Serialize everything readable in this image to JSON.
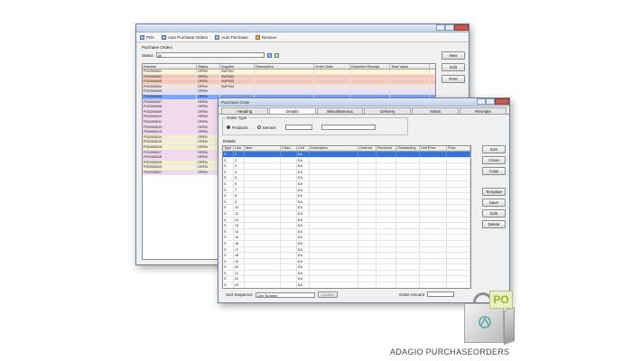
{
  "back_window": {
    "toolbar": {
      "items": [
        "POs",
        "Auto Purchase Orders",
        "Auto Purchase",
        "Receive"
      ]
    },
    "filter": {
      "group_label": "Purchase Orders",
      "status_label": "Status",
      "status_value": "All"
    },
    "grid": {
      "columns": [
        "Number",
        "Status",
        "Supplier",
        "Description",
        "Order Date",
        "Expected Receipt",
        "Total Value"
      ],
      "rows": [
        {
          "number": "PO0000001",
          "status": "OPEN",
          "supplier": "SUP001",
          "description": "",
          "order_date": "",
          "expected": "",
          "total": "",
          "color": "#fff5d9"
        },
        {
          "number": "PO0000002",
          "status": "OPEN",
          "supplier": "SUP002",
          "description": "",
          "order_date": "",
          "expected": "",
          "total": "",
          "color": "#f7c8b8"
        },
        {
          "number": "PO0000003",
          "status": "OPEN",
          "supplier": "SUP003",
          "description": "",
          "order_date": "",
          "expected": "",
          "total": "",
          "color": "#f7c8b8"
        },
        {
          "number": "PO0000004",
          "status": "OPEN",
          "supplier": "SUP004",
          "description": "",
          "order_date": "",
          "expected": "",
          "total": "",
          "color": "#f5e2e2"
        },
        {
          "number": "PO0000005",
          "status": "OPEN",
          "supplier": "",
          "description": "",
          "order_date": "",
          "expected": "",
          "total": "",
          "color": "#e8e0f5"
        },
        {
          "number": "PO0000006",
          "status": "OPEN",
          "supplier": "",
          "description": "",
          "order_date": "",
          "expected": "",
          "total": "",
          "color": "#7fa6ff"
        },
        {
          "number": "PO0000007",
          "status": "OPEN",
          "supplier": "",
          "description": "",
          "order_date": "",
          "expected": "",
          "total": "",
          "color": "#f5d8f0"
        },
        {
          "number": "PO0000008",
          "status": "OPEN",
          "supplier": "",
          "description": "",
          "order_date": "",
          "expected": "",
          "total": "",
          "color": "#f5d8f0"
        },
        {
          "number": "PO0000009",
          "status": "OPEN",
          "supplier": "",
          "description": "",
          "order_date": "",
          "expected": "",
          "total": "",
          "color": "#f5d8f0"
        },
        {
          "number": "PO0000010",
          "status": "OPEN",
          "supplier": "",
          "description": "",
          "order_date": "",
          "expected": "",
          "total": "",
          "color": "#f5d8f0"
        },
        {
          "number": "PO0000011",
          "status": "OPEN",
          "supplier": "",
          "description": "",
          "order_date": "",
          "expected": "",
          "total": "",
          "color": "#f5d8f0"
        },
        {
          "number": "PO0000012",
          "status": "OPEN",
          "supplier": "",
          "description": "",
          "order_date": "",
          "expected": "",
          "total": "",
          "color": "#f5d8f0"
        },
        {
          "number": "PO0000013",
          "status": "OPEN",
          "supplier": "",
          "description": "",
          "order_date": "",
          "expected": "",
          "total": "",
          "color": "#f5d8f0"
        },
        {
          "number": "PO0000014",
          "status": "OPEN",
          "supplier": "",
          "description": "",
          "order_date": "",
          "expected": "",
          "total": "",
          "color": "#f5f0d2"
        },
        {
          "number": "PO0000015",
          "status": "OPEN",
          "supplier": "",
          "description": "",
          "order_date": "",
          "expected": "",
          "total": "",
          "color": "#f5f0d2"
        },
        {
          "number": "PO0000016",
          "status": "OPEN",
          "supplier": "",
          "description": "",
          "order_date": "",
          "expected": "",
          "total": "",
          "color": "#f5f0d2"
        },
        {
          "number": "PO0000017",
          "status": "OPEN",
          "supplier": "",
          "description": "",
          "order_date": "",
          "expected": "",
          "total": "",
          "color": "#f5d8f0"
        },
        {
          "number": "PO0000018",
          "status": "OPEN",
          "supplier": "",
          "description": "",
          "order_date": "",
          "expected": "",
          "total": "",
          "color": "#f5d8f0"
        },
        {
          "number": "PO0000019",
          "status": "OPEN",
          "supplier": "",
          "description": "",
          "order_date": "",
          "expected": "",
          "total": "",
          "color": "#f5f0d2"
        },
        {
          "number": "PO0000020",
          "status": "OPEN",
          "supplier": "",
          "description": "",
          "order_date": "",
          "expected": "",
          "total": "",
          "color": "#f5f0d2"
        },
        {
          "number": "PO0000021",
          "status": "OPEN",
          "supplier": "",
          "description": "",
          "order_date": "",
          "expected": "",
          "total": "",
          "color": "#f5d8f0"
        }
      ]
    },
    "side_buttons": [
      "New",
      "Edit",
      "Print"
    ]
  },
  "front_window": {
    "title": "Purchase Order",
    "tabs": [
      "Heading",
      "Details",
      "Miscellaneous",
      "Delivery",
      "Notes",
      "Receipts"
    ],
    "order_type_label": "Order Type",
    "radio_product": "Products",
    "radio_service": "Service",
    "lines_label": "Details",
    "grid": {
      "columns": [
        "Type",
        "Line",
        "Item",
        "Class",
        "Unit",
        "Description",
        "Ordered",
        "Received",
        "Outstanding",
        "Unit Price",
        "Price"
      ],
      "rows": [
        {
          "type": "S",
          "line": "1",
          "item": "",
          "class": "",
          "unit": "EA",
          "description": "",
          "ordered": "",
          "received": "",
          "outstanding": "",
          "unit_price": "",
          "price": ""
        },
        {
          "type": "S",
          "line": "2",
          "item": "",
          "class": "",
          "unit": "EA",
          "description": "",
          "ordered": "",
          "received": "",
          "outstanding": "",
          "unit_price": "",
          "price": ""
        },
        {
          "type": "S",
          "line": "3",
          "item": "",
          "class": "",
          "unit": "EA",
          "description": "",
          "ordered": "",
          "received": "",
          "outstanding": "",
          "unit_price": "",
          "price": ""
        },
        {
          "type": "S",
          "line": "4",
          "item": "",
          "class": "",
          "unit": "EA",
          "description": "",
          "ordered": "",
          "received": "",
          "outstanding": "",
          "unit_price": "",
          "price": ""
        },
        {
          "type": "S",
          "line": "5",
          "item": "",
          "class": "",
          "unit": "EA",
          "description": "",
          "ordered": "",
          "received": "",
          "outstanding": "",
          "unit_price": "",
          "price": ""
        },
        {
          "type": "S",
          "line": "6",
          "item": "",
          "class": "",
          "unit": "EA",
          "description": "",
          "ordered": "",
          "received": "",
          "outstanding": "",
          "unit_price": "",
          "price": ""
        },
        {
          "type": "S",
          "line": "7",
          "item": "",
          "class": "",
          "unit": "EA",
          "description": "",
          "ordered": "",
          "received": "",
          "outstanding": "",
          "unit_price": "",
          "price": ""
        },
        {
          "type": "S",
          "line": "8",
          "item": "",
          "class": "",
          "unit": "EA",
          "description": "",
          "ordered": "",
          "received": "",
          "outstanding": "",
          "unit_price": "",
          "price": ""
        },
        {
          "type": "S",
          "line": "9",
          "item": "",
          "class": "",
          "unit": "EA",
          "description": "",
          "ordered": "",
          "received": "",
          "outstanding": "",
          "unit_price": "",
          "price": ""
        },
        {
          "type": "S",
          "line": "10",
          "item": "",
          "class": "",
          "unit": "EA",
          "description": "",
          "ordered": "",
          "received": "",
          "outstanding": "",
          "unit_price": "",
          "price": ""
        },
        {
          "type": "S",
          "line": "11",
          "item": "",
          "class": "",
          "unit": "EA",
          "description": "",
          "ordered": "",
          "received": "",
          "outstanding": "",
          "unit_price": "",
          "price": ""
        },
        {
          "type": "S",
          "line": "12",
          "item": "",
          "class": "",
          "unit": "EA",
          "description": "",
          "ordered": "",
          "received": "",
          "outstanding": "",
          "unit_price": "",
          "price": ""
        },
        {
          "type": "S",
          "line": "13",
          "item": "",
          "class": "",
          "unit": "EA",
          "description": "",
          "ordered": "",
          "received": "",
          "outstanding": "",
          "unit_price": "",
          "price": ""
        },
        {
          "type": "S",
          "line": "14",
          "item": "",
          "class": "",
          "unit": "EA",
          "description": "",
          "ordered": "",
          "received": "",
          "outstanding": "",
          "unit_price": "",
          "price": ""
        },
        {
          "type": "S",
          "line": "15",
          "item": "",
          "class": "",
          "unit": "EA",
          "description": "",
          "ordered": "",
          "received": "",
          "outstanding": "",
          "unit_price": "",
          "price": ""
        },
        {
          "type": "S",
          "line": "16",
          "item": "",
          "class": "",
          "unit": "EA",
          "description": "",
          "ordered": "",
          "received": "",
          "outstanding": "",
          "unit_price": "",
          "price": ""
        },
        {
          "type": "S",
          "line": "17",
          "item": "",
          "class": "",
          "unit": "EA",
          "description": "",
          "ordered": "",
          "received": "",
          "outstanding": "",
          "unit_price": "",
          "price": ""
        },
        {
          "type": "S",
          "line": "18",
          "item": "",
          "class": "",
          "unit": "EA",
          "description": "",
          "ordered": "",
          "received": "",
          "outstanding": "",
          "unit_price": "",
          "price": ""
        },
        {
          "type": "S",
          "line": "19",
          "item": "",
          "class": "",
          "unit": "EA",
          "description": "",
          "ordered": "",
          "received": "",
          "outstanding": "",
          "unit_price": "",
          "price": ""
        },
        {
          "type": "S",
          "line": "20",
          "item": "",
          "class": "",
          "unit": "EA",
          "description": "",
          "ordered": "",
          "received": "",
          "outstanding": "",
          "unit_price": "",
          "price": ""
        },
        {
          "type": "S",
          "line": "21",
          "item": "",
          "class": "",
          "unit": "EA",
          "description": "",
          "ordered": "",
          "received": "",
          "outstanding": "",
          "unit_price": "",
          "price": ""
        },
        {
          "type": "S",
          "line": "22",
          "item": "",
          "class": "",
          "unit": "EA",
          "description": "",
          "ordered": "",
          "received": "",
          "outstanding": "",
          "unit_price": "",
          "price": ""
        },
        {
          "type": "S",
          "line": "23",
          "item": "",
          "class": "",
          "unit": "EA",
          "description": "",
          "ordered": "",
          "received": "",
          "outstanding": "",
          "unit_price": "",
          "price": ""
        }
      ]
    },
    "side_buttons": [
      "Exit",
      "Close",
      "Copy",
      "Template",
      "Save",
      "Edit",
      "Delete"
    ],
    "sort_label": "Sort Sequence",
    "sort_value": "Line Number",
    "update_button": "Update",
    "total_label": "Order Amount",
    "total_value": ""
  },
  "product": {
    "tag": "PO",
    "name": "ADAGIO PURCHASEORDERS"
  },
  "colors": {
    "selection": "#3874d8",
    "po_tag_text": "#9ab81e",
    "window_border": "#6d7f96"
  }
}
